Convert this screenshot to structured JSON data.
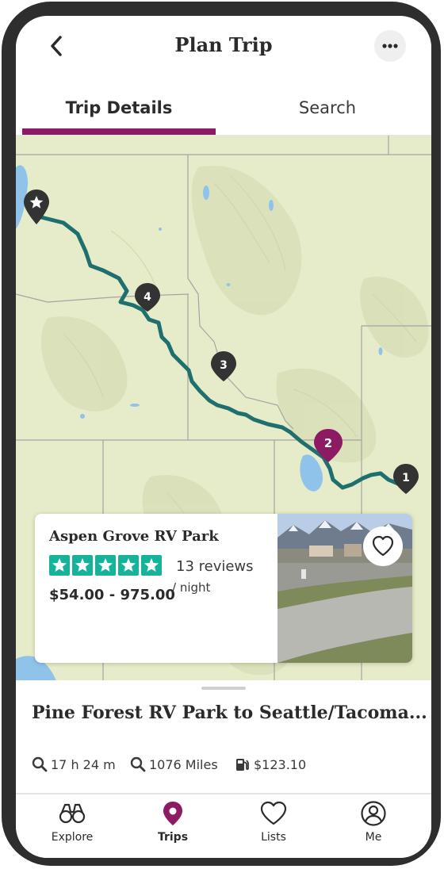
{
  "header": {
    "title": "Plan Trip"
  },
  "tabs": [
    {
      "label": "Trip Details",
      "active": true
    },
    {
      "label": "Search",
      "active": false
    }
  ],
  "map": {
    "markers": [
      {
        "label": "1",
        "color": "#333333"
      },
      {
        "label": "2",
        "color": "#8c1b63"
      },
      {
        "label": "3",
        "color": "#333333"
      },
      {
        "label": "4",
        "color": "#333333"
      }
    ],
    "destination_icon": "star-icon",
    "route_color": "#1f6f6f"
  },
  "campground_card": {
    "name": "Aspen Grove RV Park",
    "rating": 5,
    "reviews": "13 reviews",
    "price": "$54.00 - 975.00",
    "per_night": "/ night",
    "favorite_icon": "heart-icon"
  },
  "trip_summary": {
    "route_title": "Pine Forest RV Park to Seattle/Tacoma...",
    "duration": "17 h 24 m",
    "distance": "1076 Miles",
    "fuel_cost": "$123.10"
  },
  "bottom_nav": [
    {
      "label": "Explore",
      "icon": "binoculars-icon"
    },
    {
      "label": "Trips",
      "icon": "map-pin-icon",
      "active": true
    },
    {
      "label": "Lists",
      "icon": "heart-icon"
    },
    {
      "label": "Me",
      "icon": "user-icon"
    }
  ],
  "colors": {
    "accent": "#8c1b63",
    "stars": "#16b39b"
  }
}
